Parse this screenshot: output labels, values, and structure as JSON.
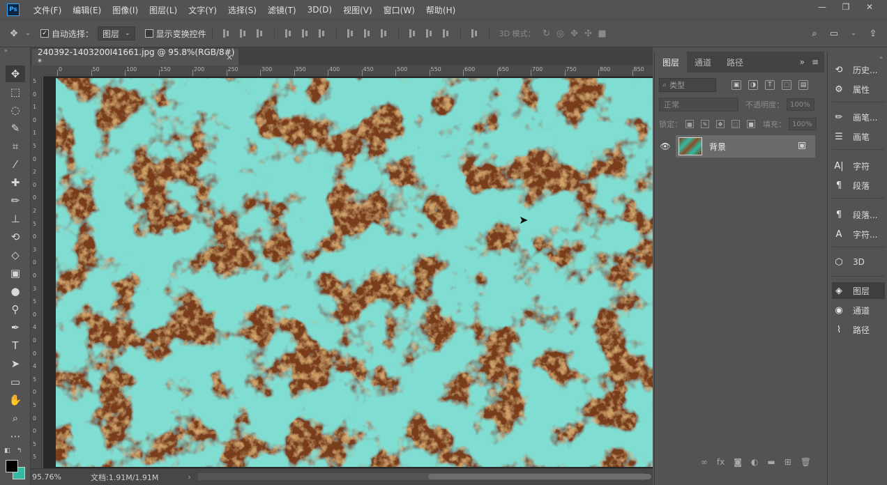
{
  "app": {
    "logo": "Ps"
  },
  "menu": [
    "文件(F)",
    "编辑(E)",
    "图像(I)",
    "图层(L)",
    "文字(Y)",
    "选择(S)",
    "滤镜(T)",
    "3D(D)",
    "视图(V)",
    "窗口(W)",
    "帮助(H)"
  ],
  "options": {
    "auto_select_label": "自动选择：",
    "auto_select_value": "图层",
    "show_transform_label": "显示变换控件",
    "mode_3d_label": "3D 模式："
  },
  "document": {
    "tab_title": "240392-1403200I41661.jpg @ 95.8%(RGB/8#) *",
    "close": "×"
  },
  "ruler": {
    "h_ticks": [
      "0",
      "50",
      "100",
      "150",
      "200",
      "250",
      "300",
      "350",
      "400",
      "450",
      "500",
      "550",
      "600",
      "650",
      "700",
      "750",
      "800",
      "850"
    ],
    "v_ticks": [
      "5",
      "0",
      "1",
      "0",
      "1",
      "5",
      "0",
      "2",
      "0",
      "0",
      "2",
      "5",
      "0",
      "3",
      "0",
      "0",
      "3",
      "5",
      "0",
      "4",
      "0",
      "0",
      "4",
      "5",
      "0",
      "5",
      "0",
      "0",
      "5",
      "5"
    ]
  },
  "status": {
    "zoom": "95.76%",
    "doc_size": "文档:1.91M/1.91M",
    "arrow": "›"
  },
  "layers_panel": {
    "tabs": [
      "图层",
      "通道",
      "路径"
    ],
    "search_placeholder": "类型",
    "blend_mode": "正常",
    "opacity_label": "不透明度：",
    "opacity_value": "100%",
    "lock_label": "锁定：",
    "fill_label": "填充：",
    "fill_value": "100%",
    "layer_name": "背景",
    "bottom_icons": [
      "link-icon",
      "fx-icon",
      "mask-icon",
      "adjustment-icon",
      "folder-icon",
      "new-layer-icon",
      "trash-icon"
    ]
  },
  "dock": [
    "历史...",
    "属性",
    "画笔...",
    "画笔",
    "字符",
    "段落",
    "段落...",
    "字符...",
    "3D",
    "图层",
    "通道",
    "路径"
  ],
  "colors": {
    "teal_paint": "#35b9a2",
    "rust": "#7a3d1a",
    "ui_bg": "#535353",
    "ps_blue": "#31a8ff"
  }
}
